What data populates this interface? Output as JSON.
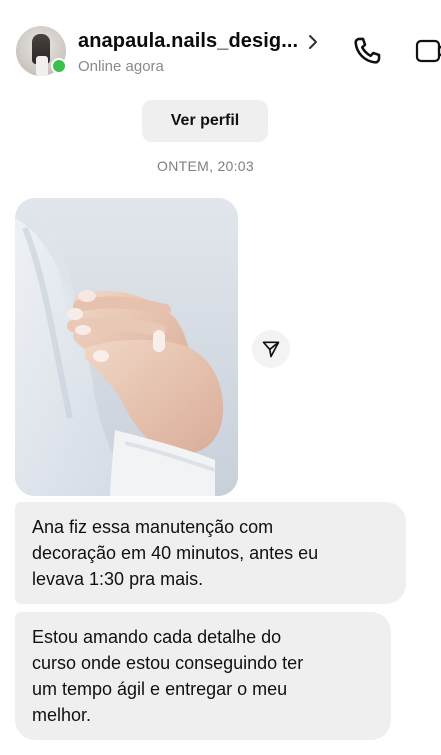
{
  "header": {
    "username": "anapaula.nails_desig...",
    "status": "Online agora",
    "chevron_icon": "chevron-right-icon",
    "call_icon": "phone-icon",
    "video_icon": "video-camera-icon",
    "online_color": "#38c24a"
  },
  "thread": {
    "ver_perfil_label": "Ver perfil",
    "timestamp": "ONTEM, 20:03",
    "photo_icon": "nail-photo",
    "share_icon": "share-icon",
    "messages": [
      {
        "lines": [
          "Ana fiz essa manutenção com",
          "decoração em 40 minutos, antes eu",
          "levava 1:30 pra mais."
        ]
      },
      {
        "lines": [
          "Estou amando cada detalhe do",
          "curso onde estou conseguindo ter",
          "um tempo ágil e entregar o meu",
          "melhor."
        ]
      }
    ]
  },
  "colors": {
    "bubble_bg": "#efefef",
    "text": "#111111",
    "muted": "#8a8a8a"
  }
}
